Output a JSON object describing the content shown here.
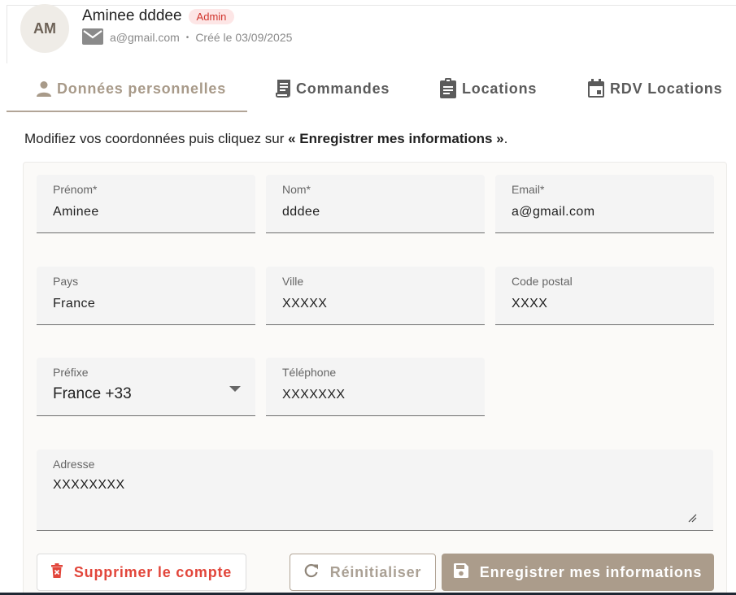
{
  "header": {
    "avatar_initials": "AM",
    "user_name": "Aminee dddee",
    "role_badge": "Admin",
    "email": "a@gmail.com",
    "separator": "•",
    "created": "Créé le 03/09/2025"
  },
  "tabs": [
    {
      "label": "Données personnelles",
      "icon": "person-icon",
      "active": true
    },
    {
      "label": "Commandes",
      "icon": "receipt-icon",
      "active": false
    },
    {
      "label": "Locations",
      "icon": "clipboard-icon",
      "active": false
    },
    {
      "label": "RDV Locations",
      "icon": "calendar-icon",
      "active": false
    }
  ],
  "intro": {
    "prefix": "Modifiez vos coordonnées puis cliquez sur ",
    "emphasis": "« Enregistrer mes informations »",
    "suffix": "."
  },
  "form": {
    "prenom": {
      "label": "Prénom*",
      "value": "Aminee"
    },
    "nom": {
      "label": "Nom*",
      "value": "dddee"
    },
    "email": {
      "label": "Email*",
      "value": "a@gmail.com"
    },
    "pays": {
      "label": "Pays",
      "value": "France"
    },
    "ville": {
      "label": "Ville",
      "value": "XXXXX"
    },
    "code_postal": {
      "label": "Code postal",
      "value": "XXXX"
    },
    "prefixe": {
      "label": "Préfixe",
      "value": "France +33"
    },
    "telephone": {
      "label": "Téléphone",
      "value": "XXXXXXX"
    },
    "adresse": {
      "label": "Adresse",
      "value": "XXXXXXXX"
    }
  },
  "buttons": {
    "delete": "Supprimer le compte",
    "reset": "Réinitialiser",
    "save": "Enregistrer mes informations"
  },
  "colors": {
    "accent": "#ab9c8b",
    "danger": "#e2463b",
    "badge_bg": "#fde6e6"
  }
}
